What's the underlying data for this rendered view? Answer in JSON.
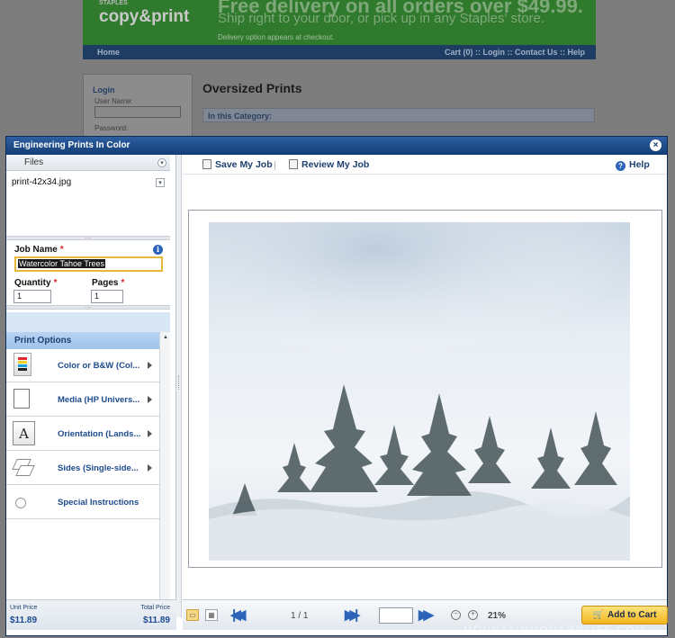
{
  "background": {
    "logo": "copy&print",
    "logo_small": "STAPLES",
    "promo_line1": "Free delivery on all orders over $49.99.",
    "promo_line2": "Ship right to your door, or pick up in any Staples' store.",
    "promo_line3": "Delivery option appears at checkout.",
    "nav_home": "Home",
    "nav_right": "Cart (0) :: Login :: Contact Us :: Help",
    "login_title": "Login",
    "login_user": "User Name:",
    "login_pass": "Password:",
    "page_title": "Oversized Prints",
    "category": "In this Category:"
  },
  "modal": {
    "title": "Engineering Prints In Color",
    "close": "×"
  },
  "files": {
    "header": "Files",
    "file_name": "print-42x34.jpg"
  },
  "job": {
    "job_name_label": "Job Name",
    "required_mark": "*",
    "job_name_value": "Watercolor Tahoe Trees",
    "quantity_label": "Quantity",
    "quantity_value": "1",
    "pages_label": "Pages",
    "pages_value": "1"
  },
  "print_options": {
    "header": "Print Options",
    "items": [
      {
        "label": "Color or B&W (Col...",
        "icon": "color-cartridge-icon"
      },
      {
        "label": "Media (HP Univers...",
        "icon": "media-paper-icon"
      },
      {
        "label": "Orientation (Lands...",
        "icon": "orientation-icon"
      },
      {
        "label": "Sides (Single-side...",
        "icon": "sides-icon"
      },
      {
        "label": "Special Instructions",
        "icon": "special-instructions-icon"
      }
    ]
  },
  "pricing": {
    "unit_label": "Unit Price",
    "unit_value": "$11.89",
    "total_label": "Total Price",
    "total_value": "$11.89"
  },
  "toolbar": {
    "save": "Save My Job",
    "review": "Review My Job",
    "help": "Help"
  },
  "viewer": {
    "page_indicator": "1 / 1",
    "zoom": "21%",
    "add_to_cart": "Add to Cart"
  },
  "watermark": "MOUNTAINMODERNLIFE.COM",
  "colors": {
    "accent_blue": "#1d4b8f",
    "titlebar": "#133d77",
    "cart_button": "#f3b51c"
  }
}
